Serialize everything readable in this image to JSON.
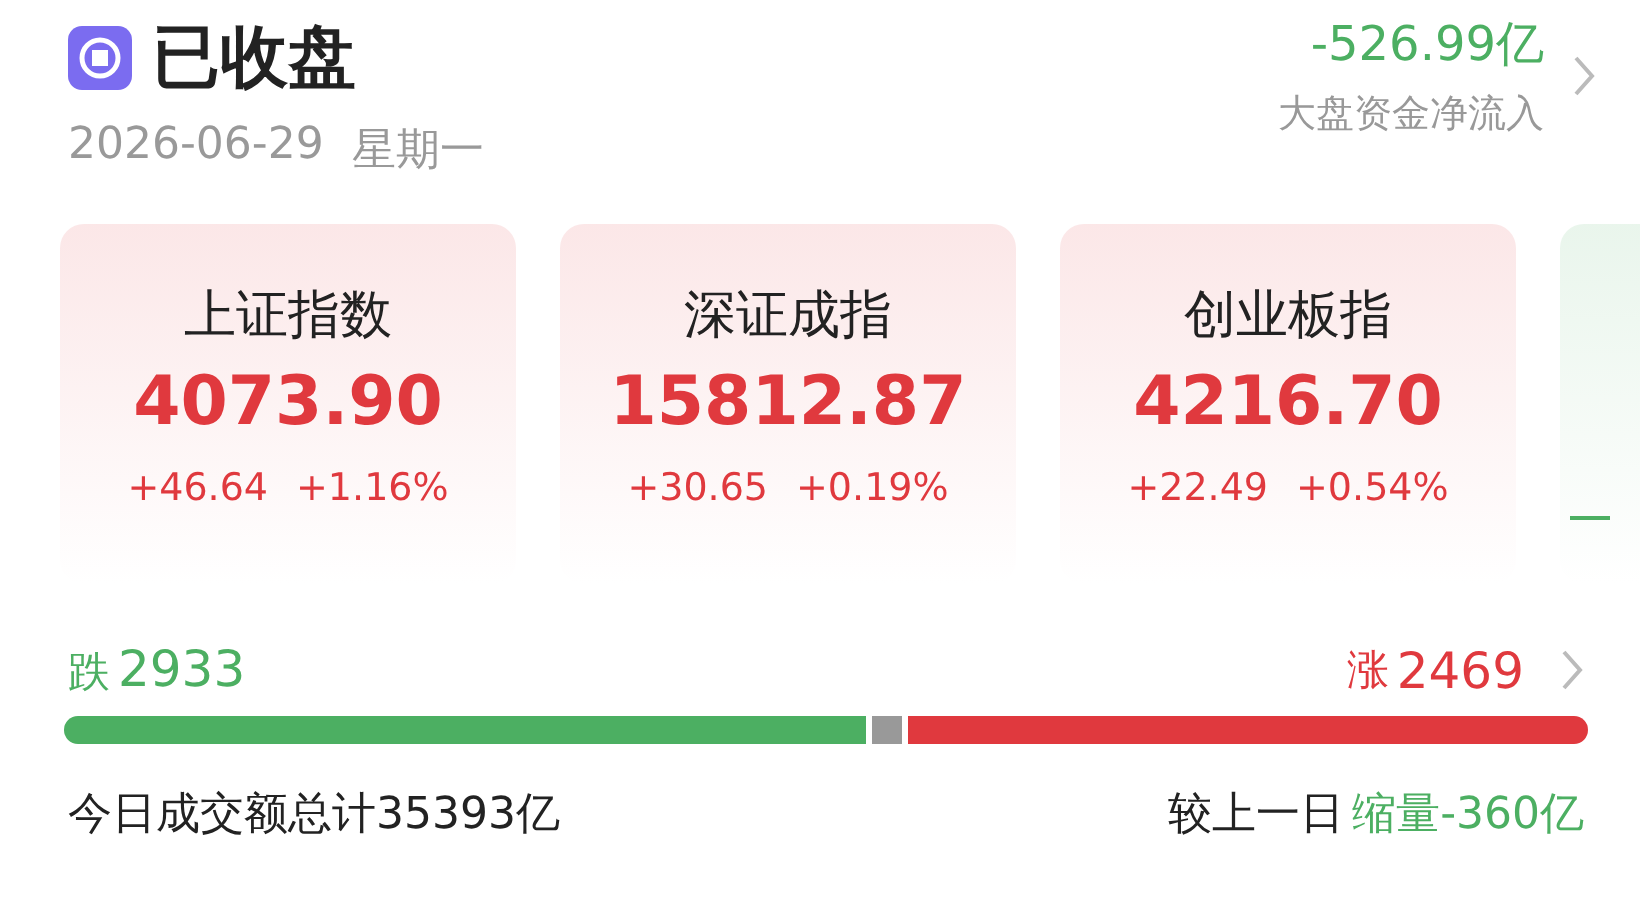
{
  "header": {
    "status": "已收盘",
    "date": "2026-06-29",
    "weekday": "星期一",
    "net_flow": {
      "value": "-526.99亿",
      "label": "大盘资金净流入"
    }
  },
  "indices": [
    {
      "name": "上证指数",
      "value": "4073.90",
      "change": "+46.64",
      "percent": "+1.16%",
      "color": "#e0393e"
    },
    {
      "name": "深证成指",
      "value": "15812.87",
      "change": "+30.65",
      "percent": "+0.19%",
      "color": "#e0393e"
    },
    {
      "name": "创业板指",
      "value": "4216.70",
      "change": "+22.49",
      "percent": "+0.54%",
      "color": "#e0393e"
    },
    {
      "kind": "partial",
      "color": "#4caf62"
    }
  ],
  "breadth": {
    "down_label": "跌",
    "down_count": "2933",
    "up_label": "涨",
    "up_count": "2469",
    "segments": [
      {
        "kind": "down"
      },
      {
        "kind": "flat"
      },
      {
        "kind": "up"
      }
    ]
  },
  "turnover": {
    "text": "今日成交额总计35393亿",
    "compare_label": "较上一日",
    "compare_value": "缩量-360亿"
  }
}
